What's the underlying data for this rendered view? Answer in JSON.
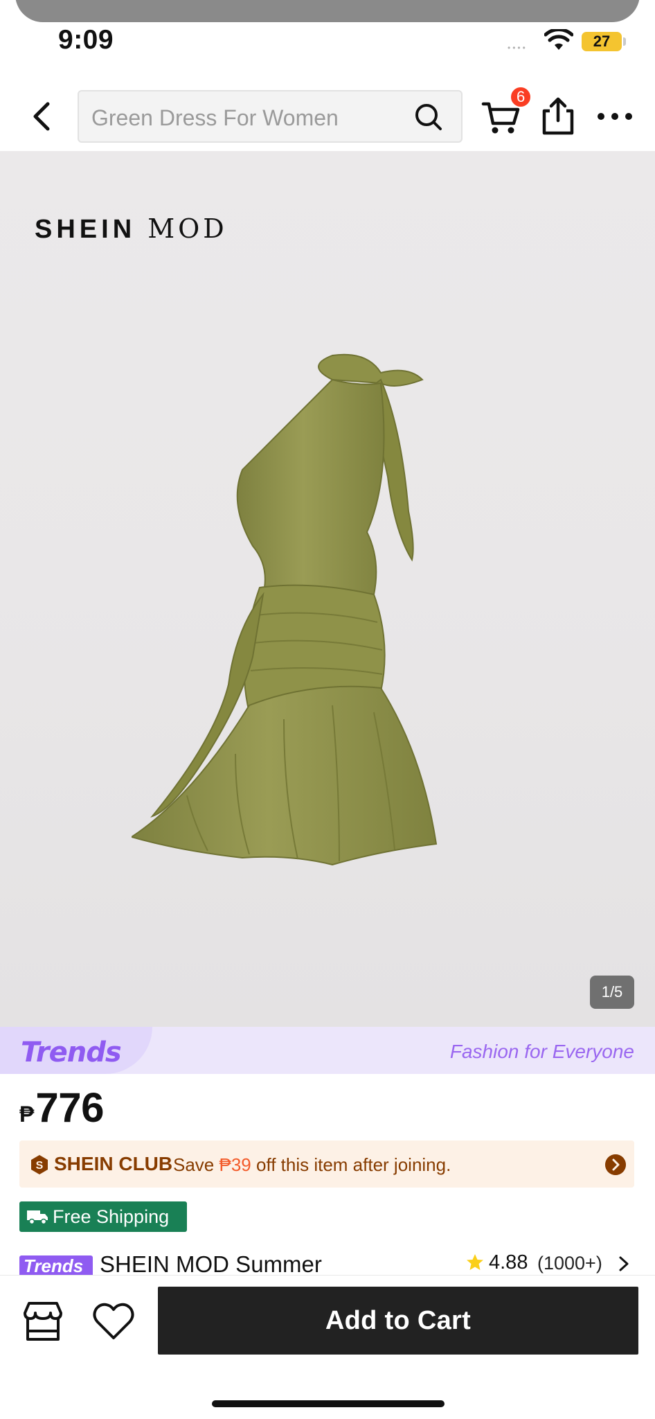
{
  "status_bar": {
    "time": "9:09",
    "signal_dots": "••••",
    "battery": "27"
  },
  "header": {
    "search_placeholder": "Green Dress For Women",
    "cart_count": "6"
  },
  "gallery": {
    "brand_logo_part1": "SHEIN",
    "brand_logo_part2": "MOD",
    "image_counter": "1/5",
    "dress_color": "#8e9148"
  },
  "trends_banner": {
    "logo": "Trends",
    "tagline": "Fashion for Everyone"
  },
  "price": {
    "currency": "₱",
    "value": "776"
  },
  "club": {
    "title": "SHEIN CLUB",
    "text_before": "Save",
    "saving": "₱39",
    "text_after": "off this item after joining."
  },
  "shipping": {
    "label": "Free Shipping"
  },
  "product": {
    "tag": "Trends",
    "title": "SHEIN MOD Summer",
    "rating": "4.88",
    "review_count": "(1000+)"
  },
  "action_bar": {
    "add_to_cart_label": "Add to Cart"
  },
  "colors": {
    "accent_purple": "#8f5bf1",
    "club_brown": "#873c00",
    "shipping_green": "#198055",
    "badge_red": "#fa3d22"
  }
}
